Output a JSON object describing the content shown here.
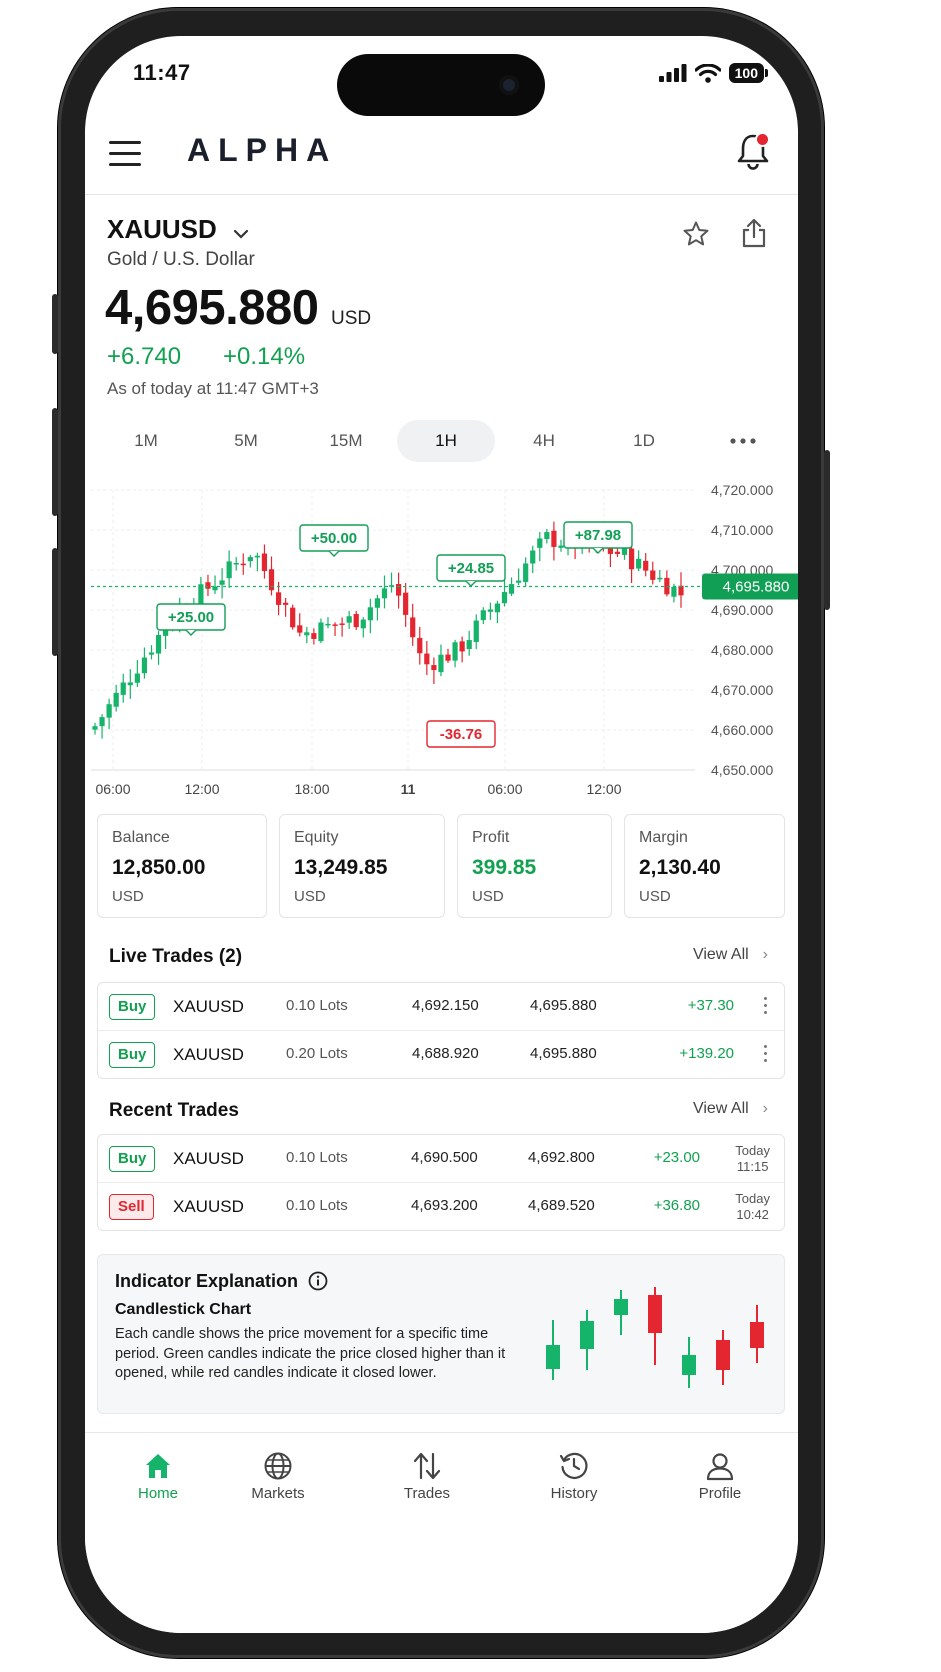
{
  "status_bar": {
    "time": "11:47",
    "battery": "100"
  },
  "header": {
    "logo": "ALPHA"
  },
  "instrument": {
    "symbol": "XAUUSD",
    "name": "Gold / U.S. Dollar",
    "price": "4,695.880",
    "price_unit": "USD",
    "change_abs": "+6.740",
    "change_pct": "+0.14%",
    "as_of": "As of today at 11:47 GMT+3"
  },
  "timeframes": [
    "1M",
    "5M",
    "15M",
    "1H",
    "4H",
    "1D"
  ],
  "active_timeframe": "1H",
  "chart_data": {
    "type": "candlestick",
    "y_ticks": [
      "4,720.000",
      "4,710.000",
      "4,700.000",
      "4,690.000",
      "4,680.000",
      "4,670.000",
      "4,660.000",
      "4,650.000"
    ],
    "x_ticks": [
      "06:00",
      "12:00",
      "18:00",
      "11",
      "06:00",
      "12:00"
    ],
    "ylim": [
      4650,
      4720
    ],
    "current_price_label": "4,695.880",
    "current_price": 4695.88,
    "annotations": [
      {
        "text": "+25.00",
        "type": "gain"
      },
      {
        "text": "+50.00",
        "type": "gain"
      },
      {
        "text": "+24.85",
        "type": "gain"
      },
      {
        "text": "+87.98",
        "type": "gain"
      },
      {
        "text": "-36.76",
        "type": "loss"
      }
    ],
    "colors": {
      "up": "#16b36a",
      "down": "#e3262f"
    }
  },
  "account": [
    {
      "label": "Balance",
      "value": "12,850.00",
      "currency": "USD",
      "highlight": false
    },
    {
      "label": "Equity",
      "value": "13,249.85",
      "currency": "USD",
      "highlight": false
    },
    {
      "label": "Profit",
      "value": "399.85",
      "currency": "USD",
      "highlight": true
    },
    {
      "label": "Margin",
      "value": "2,130.40",
      "currency": "USD",
      "highlight": false
    }
  ],
  "live_trades": {
    "title": "Live Trades (2)",
    "view_all": "View All",
    "rows": [
      {
        "side": "Buy",
        "symbol": "XAUUSD",
        "lots": "0.10 Lots",
        "open": "4,692.150",
        "current": "4,695.880",
        "pl": "+37.30"
      },
      {
        "side": "Buy",
        "symbol": "XAUUSD",
        "lots": "0.20 Lots",
        "open": "4,688.920",
        "current": "4,695.880",
        "pl": "+139.20"
      }
    ]
  },
  "recent_trades": {
    "title": "Recent Trades",
    "view_all": "View All",
    "rows": [
      {
        "side": "Buy",
        "symbol": "XAUUSD",
        "lots": "0.10 Lots",
        "open": "4,690.500",
        "close": "4,692.800",
        "pl": "+23.00",
        "day": "Today",
        "time": "11:15"
      },
      {
        "side": "Sell",
        "symbol": "XAUUSD",
        "lots": "0.10 Lots",
        "open": "4,693.200",
        "close": "4,689.520",
        "pl": "+36.80",
        "day": "Today",
        "time": "10:42"
      }
    ]
  },
  "indicator": {
    "title": "Indicator Explanation",
    "subtitle": "Candlestick Chart",
    "text": "Each candle shows the price movement for a specific time period. Green candles indicate the price closed higher than it opened, while red candles indicate it closed lower."
  },
  "nav": [
    {
      "label": "Home",
      "icon": "home-icon",
      "active": true
    },
    {
      "label": "Markets",
      "icon": "globe-icon",
      "active": false
    },
    {
      "label": "Trades",
      "icon": "arrows-updown-icon",
      "active": false
    },
    {
      "label": "History",
      "icon": "history-icon",
      "active": false
    },
    {
      "label": "Profile",
      "icon": "profile-icon",
      "active": false
    }
  ]
}
